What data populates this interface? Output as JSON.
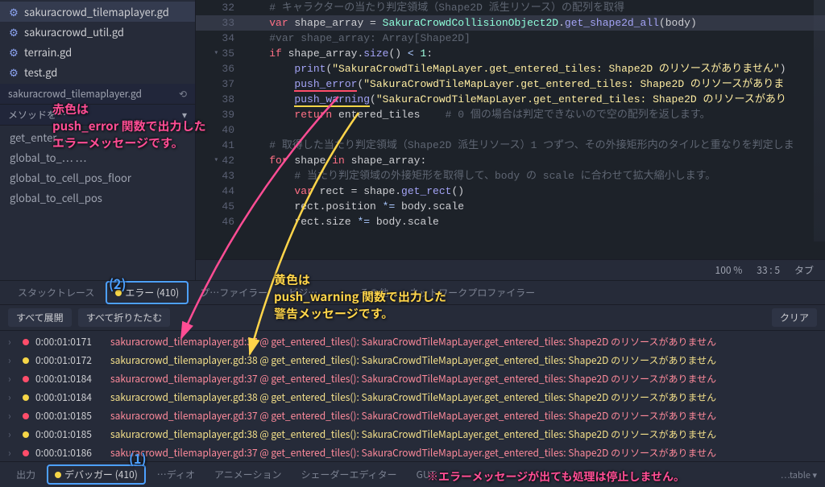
{
  "sidebar": {
    "files": [
      {
        "name": "sakuracrowd_tilemaplayer.gd",
        "active": true
      },
      {
        "name": "sakuracrowd_util.gd",
        "active": false
      },
      {
        "name": "terrain.gd",
        "active": false
      },
      {
        "name": "test.gd",
        "active": false
      }
    ],
    "breadcrumb": "sakuracrowd_tilemaplayer.gd",
    "method_label": "メソッドを…",
    "methods": [
      "get_enter…",
      "global_to_… …",
      "global_to_cell_pos_floor",
      "global_to_cell_pos"
    ]
  },
  "code": {
    "lines": [
      {
        "n": 32,
        "html": "<span class='comment'># キャラクターの当たり判定領域（Shape2D 派生リソース）の配列を取得</span>"
      },
      {
        "n": 33,
        "html": "<span class='kw'>var</span> shape_array = <span class='type'>SakuraCrowdCollisionObject2D</span>.<span class='fn'>get_shape2d_all</span>(body)",
        "hl": true
      },
      {
        "n": 34,
        "html": "<span class='comment'>#var shape_array: Array[Shape2D]</span>"
      },
      {
        "n": 35,
        "html": "<span class='kw'>if</span> shape_array.<span class='fn'>size</span>() <span class='op'>&lt;</span> <span class='num'>1</span>:",
        "fold": true
      },
      {
        "n": 36,
        "html": "    <span class='fn'>print</span>(<span class='str'>\"SakuraCrowdTileMapLayer.get_entered_tiles: Shape2D のリソースがありません\"</span>)"
      },
      {
        "n": 37,
        "html": "    <span class='fn underline-red'>push_error</span>(<span class='str'>\"SakuraCrowdTileMapLayer.get_entered_tiles: Shape2D のリソースがありま</span>"
      },
      {
        "n": 38,
        "html": "    <span class='fn underline-yellow'>push_warning</span>(<span class='str'>\"SakuraCrowdTileMapLayer.get_entered_tiles: Shape2D のリソースがあり</span>"
      },
      {
        "n": 39,
        "html": "    <span class='kw'>return</span> entered_tiles    <span class='comment'># 0 個の場合は判定できないので空の配列を返します。</span>"
      },
      {
        "n": 40,
        "html": ""
      },
      {
        "n": 41,
        "html": "<span class='comment'># 取得した当たり判定領域（Shape2D 派生リソース）1 つずつ、その外接矩形内のタイルと重なりを判定しま</span>"
      },
      {
        "n": 42,
        "html": "<span class='kw'>for</span> shape <span class='kw'>in</span> shape_array:",
        "fold": true
      },
      {
        "n": 43,
        "html": "    <span class='comment'># 当たり判定領域の外接矩形を取得して、body の scale に合わせて拡大縮小します。</span>"
      },
      {
        "n": 44,
        "html": "    <span class='kw'>var</span> rect = shape.<span class='fn'>get_rect</span>()"
      },
      {
        "n": 45,
        "html": "    rect.position <span class='op'>*=</span> body.scale"
      },
      {
        "n": 46,
        "html": "    rect.size <span class='op'>*=</span> body.scale"
      }
    ]
  },
  "status": {
    "zoom": "100 %",
    "cursor": "33 :   5",
    "indent": "タブ"
  },
  "debugger": {
    "tabs": [
      {
        "label": "スタックトレース"
      },
      {
        "label": "エラー (410)",
        "active": true,
        "highlighted": true
      },
      {
        "label": "プ…ファイラー"
      },
      {
        "label": "ビジ…"
      },
      {
        "label": ""
      },
      {
        "label": "その他"
      },
      {
        "label": "ネットワークプロファイラー"
      }
    ],
    "expand_all": "すべて展開",
    "collapse_all": "すべて折りたたむ",
    "clear": "クリア",
    "errors": [
      {
        "time": "0:00:01:0171",
        "type": "red",
        "msg": "sakuracrowd_tilemaplayer.gd:37 @ get_entered_tiles(): SakuraCrowdTileMapLayer.get_entered_tiles: Shape2D のリソースがありません"
      },
      {
        "time": "0:00:01:0172",
        "type": "yellow",
        "msg": "sakuracrowd_tilemaplayer.gd:38 @ get_entered_tiles(): SakuraCrowdTileMapLayer.get_entered_tiles: Shape2D のリソースがありません"
      },
      {
        "time": "0:00:01:0184",
        "type": "red",
        "msg": "sakuracrowd_tilemaplayer.gd:37 @ get_entered_tiles(): SakuraCrowdTileMapLayer.get_entered_tiles: Shape2D のリソースがありません"
      },
      {
        "time": "0:00:01:0184",
        "type": "yellow",
        "msg": "sakuracrowd_tilemaplayer.gd:38 @ get_entered_tiles(): SakuraCrowdTileMapLayer.get_entered_tiles: Shape2D のリソースがありません"
      },
      {
        "time": "0:00:01:0185",
        "type": "red",
        "msg": "sakuracrowd_tilemaplayer.gd:37 @ get_entered_tiles(): SakuraCrowdTileMapLayer.get_entered_tiles: Shape2D のリソースがありません"
      },
      {
        "time": "0:00:01:0185",
        "type": "yellow",
        "msg": "sakuracrowd_tilemaplayer.gd:38 @ get_entered_tiles(): SakuraCrowdTileMapLayer.get_entered_tiles: Shape2D のリソースがありません"
      },
      {
        "time": "0:00:01:0186",
        "type": "red",
        "msg": "sakuracrowd_tilemaplayer.gd:37 @ get_entered_tiles(): SakuraCrowdTileMapLayer.get_entered_tiles: Shape2D のリソースがありません"
      }
    ]
  },
  "output_tabs": {
    "items": [
      {
        "label": "出力"
      },
      {
        "label": "デバッガー (410)",
        "highlighted": true,
        "dot": true
      },
      {
        "label": "…ディオ"
      },
      {
        "label": "アニメーション"
      },
      {
        "label": "シェーダーエディター"
      },
      {
        "label": "GUT"
      }
    ],
    "right": "…table ▾"
  },
  "annotations": {
    "red1": "赤色は",
    "red2": "push_error 関数で出力した",
    "red3": "エラーメッセージです。",
    "yellow1": "黄色は",
    "yellow2": "push_warning 関数で出力した",
    "yellow3": "警告メッセージです。",
    "label1": "(1)",
    "label2": "(2)",
    "footer_note": "※エラーメッセージが出ても処理は停止しません。"
  }
}
